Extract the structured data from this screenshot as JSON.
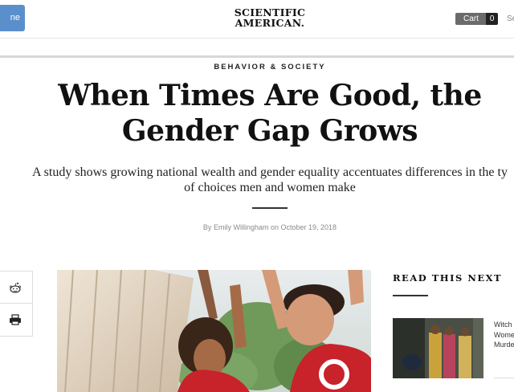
{
  "header": {
    "subscribe_label": "ne",
    "logo_line1": "SCIENTIFIC",
    "logo_line2": "AMERICAN",
    "logo_mark": ".",
    "cart_label": "Cart",
    "cart_count": "0",
    "search_label": "Se"
  },
  "article": {
    "kicker": "BEHAVIOR & SOCIETY",
    "title_line1": "When Times Are Good, the",
    "title_line2": "Gender Gap Grows",
    "dek_line1": "A study shows growing national wealth and gender equality accentuates differences in the ty",
    "dek_line2": "of choices men and women make",
    "byline_prefix": "By",
    "author": "Emily Willingham",
    "date_prefix": "on",
    "date": "October 19, 2018"
  },
  "share": {
    "items": [
      {
        "icon": "reddit-icon"
      },
      {
        "icon": "print-icon"
      }
    ]
  },
  "read_next": {
    "heading": "READ THIS NEXT",
    "items": [
      {
        "title_line1": "Witch",
        "title_line2": "Wome",
        "title_line3": "Murde"
      }
    ]
  },
  "colors": {
    "subscribe_blue": "#5b8fcb",
    "cart_gray": "#6b6b6b",
    "cart_count_bg": "#222222",
    "byline_gray": "#8a8a8a"
  }
}
